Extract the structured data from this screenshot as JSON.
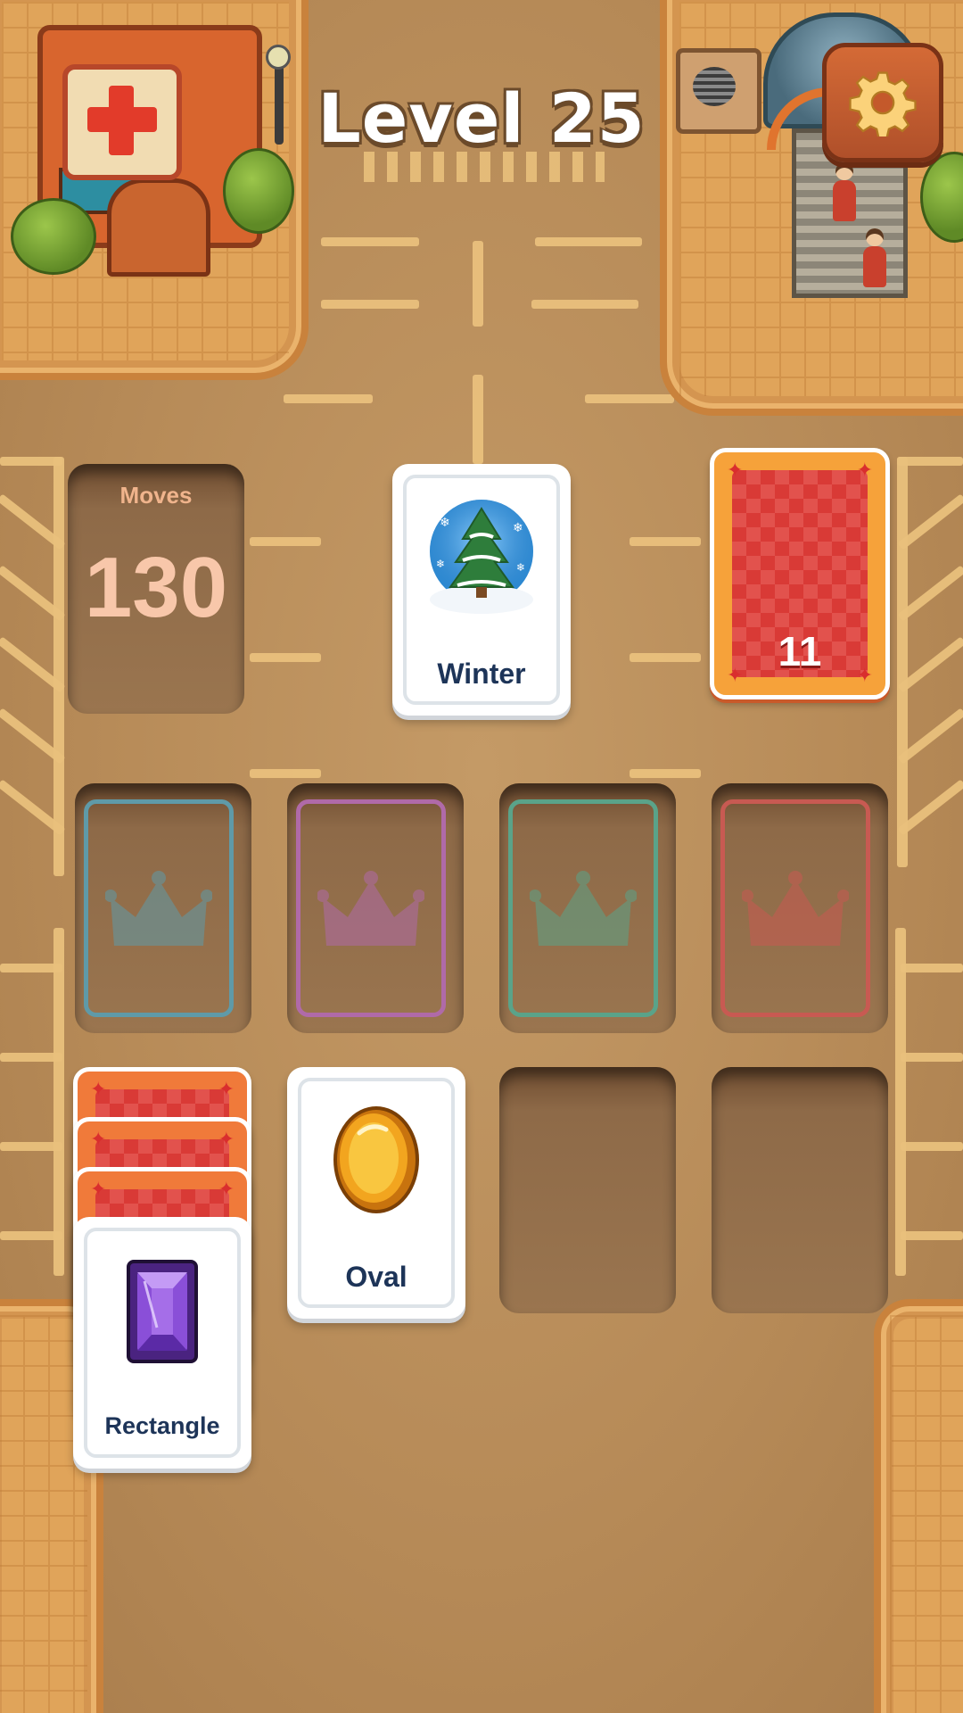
{
  "header": {
    "level_title": "Level 25"
  },
  "moves": {
    "label": "Moves",
    "value": "130"
  },
  "current_card": {
    "label": "Winter",
    "icon": "christmas-tree-snowglobe-icon"
  },
  "deck": {
    "count": "11",
    "icon": "card-back-icon"
  },
  "foundation_slots": [
    {
      "icon": "crown-icon",
      "color": "#5f9aa8"
    },
    {
      "icon": "crown-icon",
      "color": "#b06aa8"
    },
    {
      "icon": "crown-icon",
      "color": "#5aa389"
    },
    {
      "icon": "crown-icon",
      "color": "#c85a52"
    }
  ],
  "tableau": [
    {
      "label": "Rectangle",
      "icon": "purple-gem-icon",
      "stacked_backs": 3
    },
    {
      "label": "Oval",
      "icon": "gold-coin-icon"
    }
  ],
  "settings": {
    "icon": "gear-icon"
  },
  "colors": {
    "card_back": "#f07a3a",
    "card_text": "#1d3458",
    "ground": "#b78b58",
    "lines": "#e9c07c"
  }
}
